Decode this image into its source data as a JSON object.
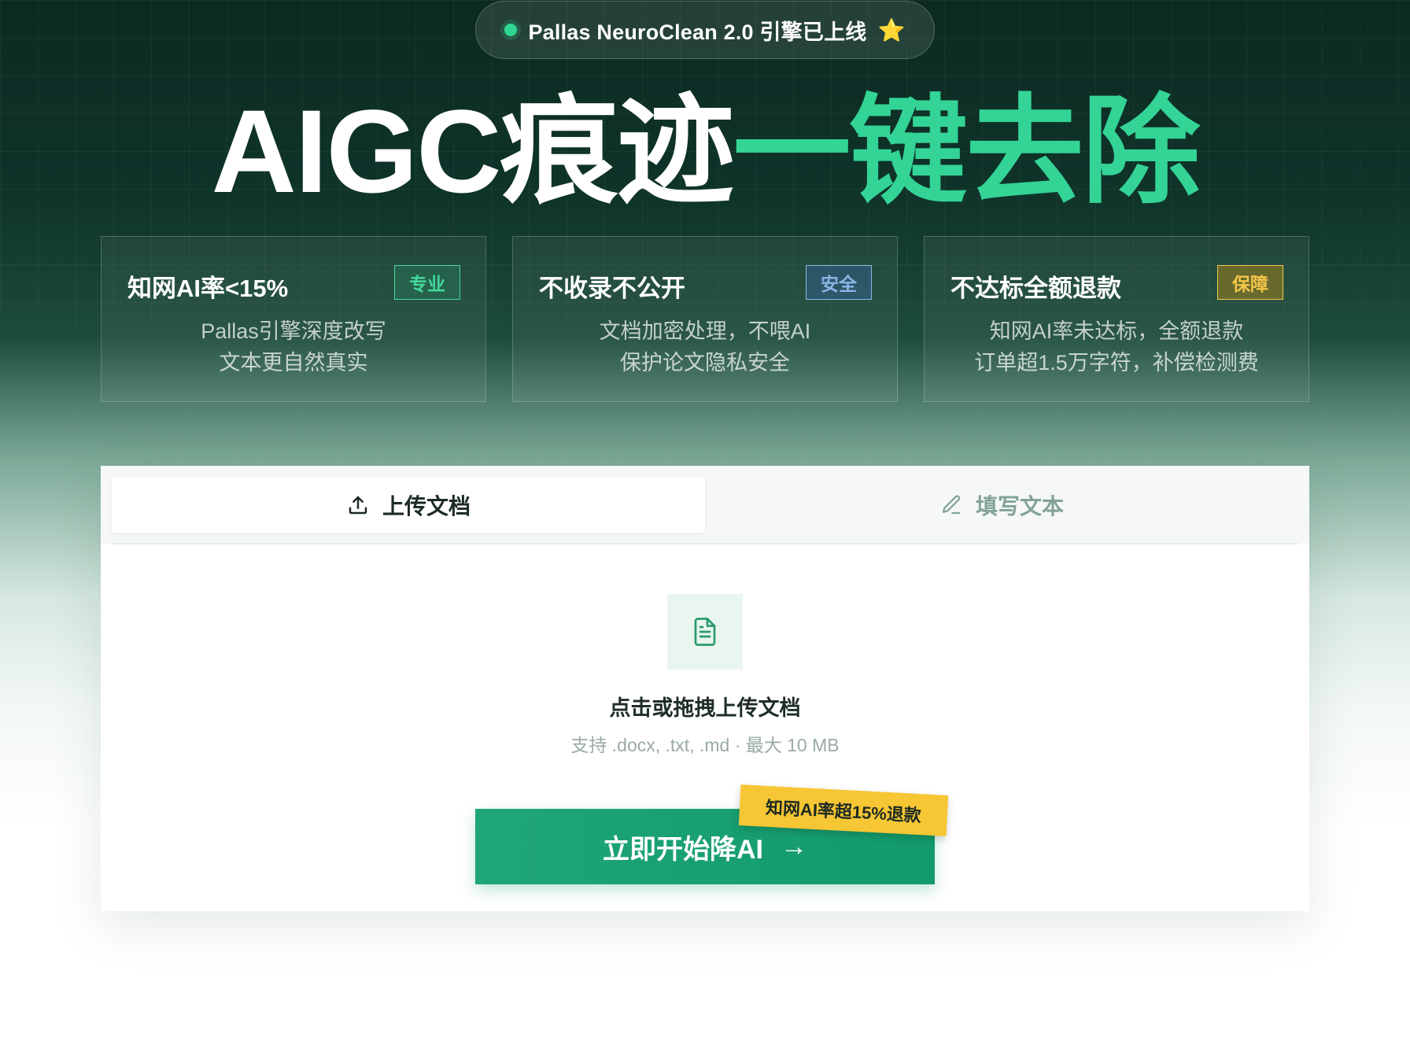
{
  "badge": {
    "text": "Pallas NeuroClean 2.0 引擎已上线",
    "star": "⭐"
  },
  "headline": {
    "part1": "AIGC痕迹",
    "part2": "一键去除"
  },
  "features": [
    {
      "title": "知网AI率<15%",
      "tag": "专业",
      "line1": "Pallas引擎深度改写",
      "line2": "文本更自然真实"
    },
    {
      "title": "不收录不公开",
      "tag": "安全",
      "line1": "文档加密处理，不喂AI",
      "line2": "保护论文隐私安全"
    },
    {
      "title": "不达标全额退款",
      "tag": "保障",
      "line1": "知网AI率未达标，全额退款",
      "line2": "订单超1.5万字符，补偿检测费"
    }
  ],
  "tabs": {
    "upload": "上传文档",
    "write": "填写文本"
  },
  "upload": {
    "title": "点击或拖拽上传文档",
    "hint": "支持 .docx, .txt, .md · 最大 10 MB"
  },
  "cta": {
    "label": "立即开始降AI",
    "arrow": "→",
    "tag": "知网AI率超15%退款"
  },
  "colors": {
    "accent": "#33d496",
    "button": "#129a6a",
    "tag_yellow": "#f6c634"
  },
  "icons": {
    "upload": "upload-icon",
    "write": "pencil-icon",
    "file": "file-text-icon",
    "status": "status-dot-icon"
  }
}
